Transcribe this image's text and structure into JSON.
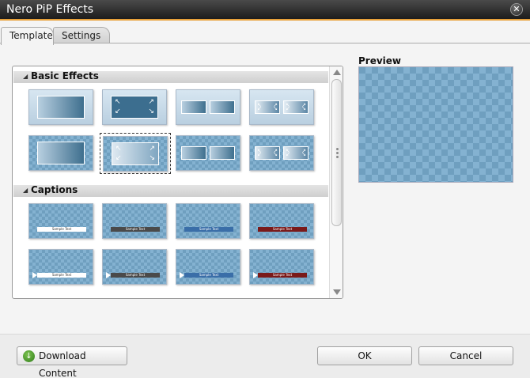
{
  "window": {
    "title": "Nero PiP Effects",
    "close_icon": "close-icon"
  },
  "tabs": [
    {
      "label": "Template",
      "active": true
    },
    {
      "label": "Settings",
      "active": false
    }
  ],
  "sections": [
    {
      "label": "Basic Effects",
      "rows": [
        [
          {
            "bg": "light",
            "style": "gradient-full"
          },
          {
            "bg": "light",
            "style": "dark-arrows"
          },
          {
            "bg": "light",
            "style": "split-gradient"
          },
          {
            "bg": "light",
            "style": "split-arrows"
          }
        ],
        [
          {
            "bg": "check",
            "style": "gradient-full"
          },
          {
            "bg": "check",
            "style": "light-arrows",
            "selected": true
          },
          {
            "bg": "check",
            "style": "split-gradient"
          },
          {
            "bg": "check",
            "style": "split-arrows"
          }
        ]
      ]
    },
    {
      "label": "Captions",
      "rows": [
        [
          {
            "caption": "Sample Text",
            "color": "#ffffff",
            "arrow": false
          },
          {
            "caption": "Sample Text",
            "color": "#4a4a4a",
            "arrow": false
          },
          {
            "caption": "Sample Text",
            "color": "#3a6ea8",
            "arrow": false
          },
          {
            "caption": "Sample Text",
            "color": "#7a1a1a",
            "arrow": false
          }
        ],
        [
          {
            "caption": "Sample Text",
            "color": "#ffffff",
            "arrow": true
          },
          {
            "caption": "Sample Text",
            "color": "#4a4a4a",
            "arrow": true
          },
          {
            "caption": "Sample Text",
            "color": "#3a6ea8",
            "arrow": true
          },
          {
            "caption": "Sample Text",
            "color": "#7a1a1a",
            "arrow": true
          }
        ]
      ]
    }
  ],
  "preview": {
    "label": "Preview"
  },
  "footer": {
    "download_label": "Download Content",
    "download_icon": "download-icon",
    "ok_label": "OK",
    "cancel_label": "Cancel"
  },
  "colors": {
    "title_accent": "#e8a13a",
    "checker_dark": "#6f9fbf",
    "checker_light": "#84b2d1"
  }
}
